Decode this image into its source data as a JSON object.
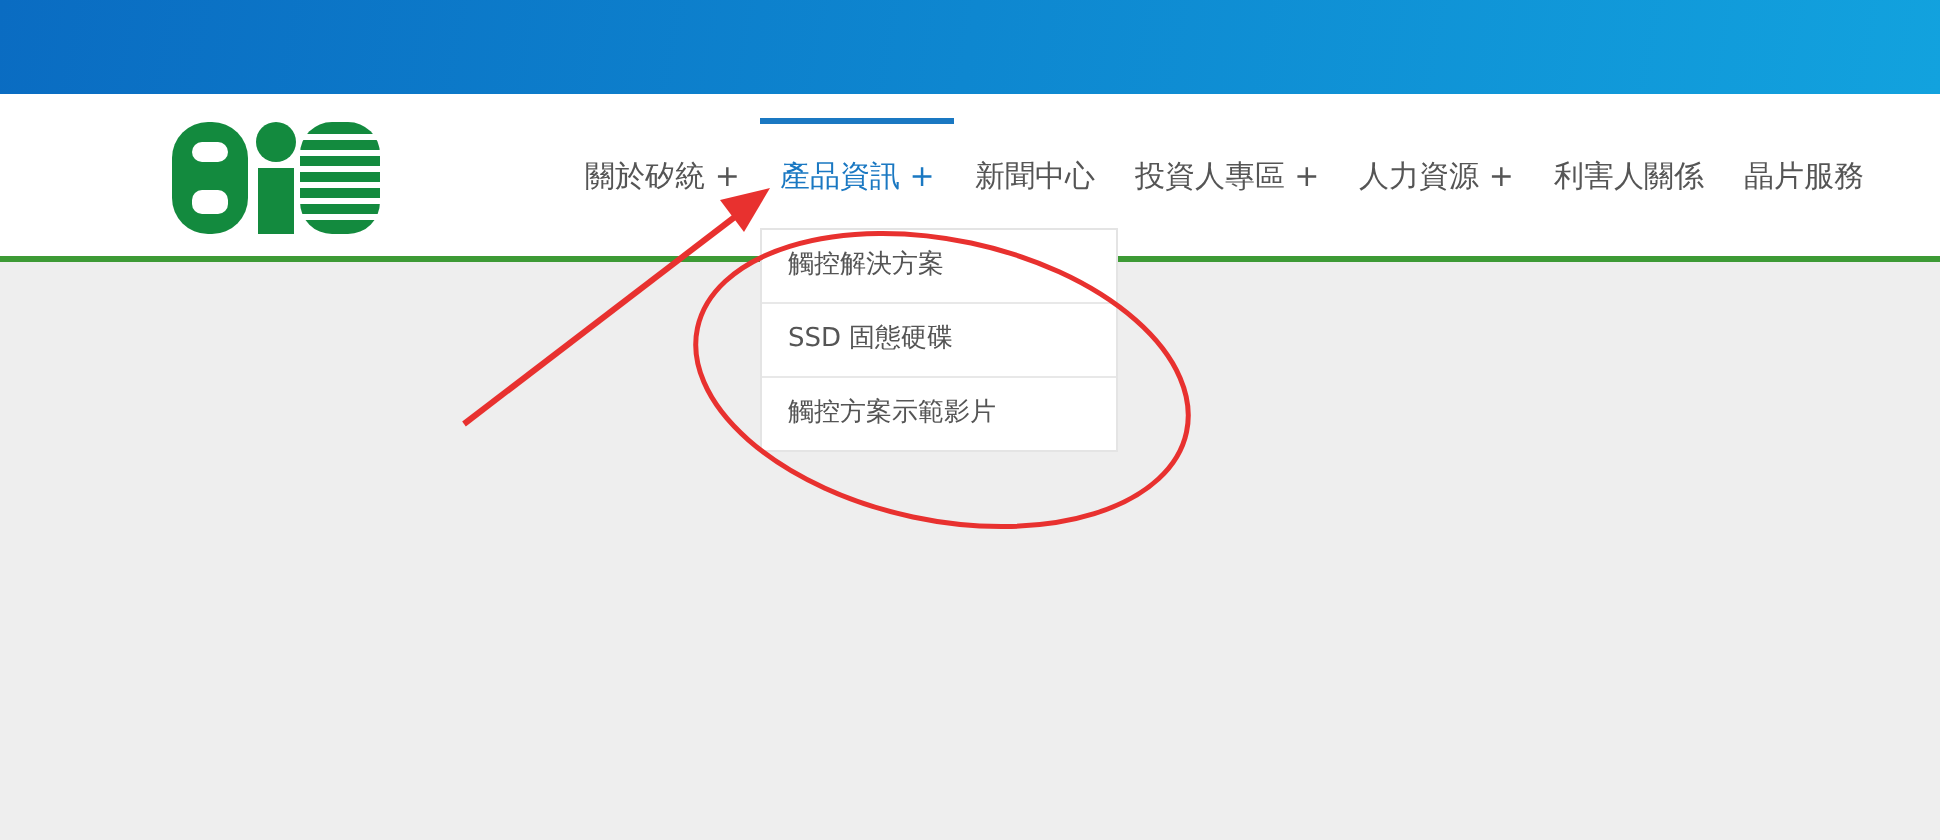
{
  "nav": [
    {
      "label": "關於矽統",
      "suffix": "+",
      "selected": false
    },
    {
      "label": "產品資訊",
      "suffix": "+",
      "selected": true,
      "submenu": [
        "觸控解決方案",
        "SSD 固態硬碟",
        "觸控方案示範影片"
      ]
    },
    {
      "label": "新聞中心",
      "selected": false
    },
    {
      "label": "投資人專區",
      "suffix": "+",
      "selected": false
    },
    {
      "label": "人力資源",
      "suffix": "+",
      "selected": false
    },
    {
      "label": "利害人關係",
      "selected": false
    },
    {
      "label": "晶片服務",
      "selected": false
    }
  ],
  "annotations": {
    "arrow": true,
    "ellipse": true
  }
}
